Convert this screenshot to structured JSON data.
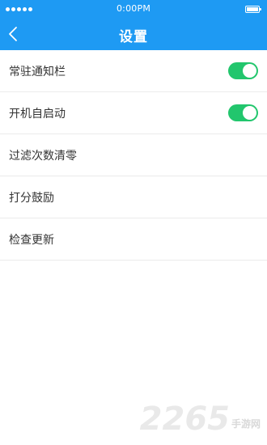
{
  "status_bar": {
    "time": "0:00PM"
  },
  "nav": {
    "title": "设置",
    "back_icon": "chevron-left-icon"
  },
  "settings": {
    "items": [
      {
        "label": "常驻通知栏",
        "toggle": true,
        "toggle_on": true
      },
      {
        "label": "开机自启动",
        "toggle": true,
        "toggle_on": true
      },
      {
        "label": "过滤次数清零",
        "toggle": false
      },
      {
        "label": "打分鼓励",
        "toggle": false
      },
      {
        "label": "检查更新",
        "toggle": false
      }
    ]
  },
  "watermark": {
    "digits": "2265",
    "text": "手游网"
  },
  "colors": {
    "header_bg": "#1e9af3",
    "toggle_on": "#22c66d"
  }
}
